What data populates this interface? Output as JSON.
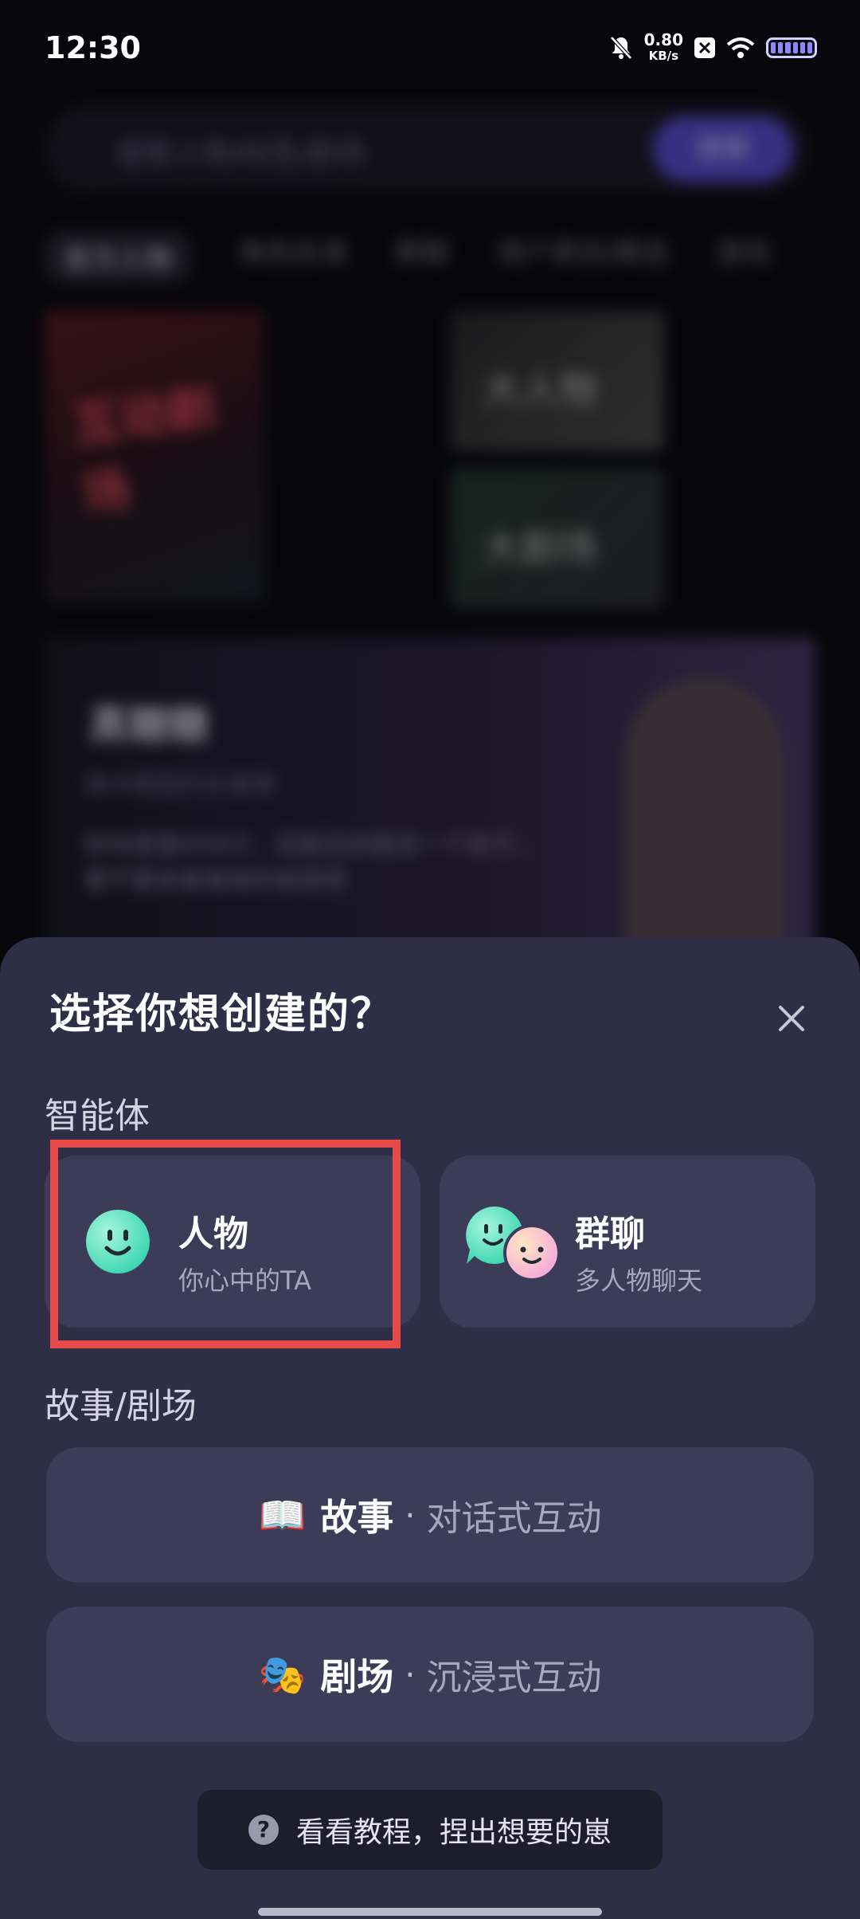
{
  "status_bar": {
    "time": "12:30",
    "net_speed": "0.80",
    "net_unit": "KB/s",
    "icons": [
      "bell-mute-icon",
      "x-app-icon",
      "wifi-icon",
      "battery-icon"
    ]
  },
  "background": {
    "search_placeholder": "搜索人物/标签/剧场",
    "search_button": "搜索",
    "tabs": [
      "官方人物",
      "角色扮演",
      "群聊",
      "用户原创/精选",
      "游戏"
    ],
    "card1_text": "互动剧场",
    "card2_text": "大人物",
    "card3_text": "大剧场",
    "banner_name": "黑糖糖",
    "banner_sub": "高冷御姐的反差萌",
    "banner_desc": "职场里雷厉风行，回家后却是另一个样子，要不要来看看她的秘密呢"
  },
  "sheet": {
    "title": "选择你想创建的？",
    "section_agents": "智能体",
    "character": {
      "label": "人物",
      "desc": "你心中的TA"
    },
    "group_chat": {
      "label": "群聊",
      "desc": "多人物聊天"
    },
    "section_story": "故事/剧场",
    "story": {
      "emoji": "📖",
      "label": "故事",
      "separator": "·",
      "desc": "对话式互动"
    },
    "theater": {
      "emoji": "🎭",
      "label": "剧场",
      "separator": "·",
      "desc": "沉浸式互动"
    },
    "tutorial": "看看教程，捏出想要的崽"
  },
  "colors": {
    "sheet_bg": "#2f2e47",
    "card_bg": "#3c3b58",
    "accent_mint": "#5fe3c2",
    "highlight_red": "#e84a4a"
  }
}
